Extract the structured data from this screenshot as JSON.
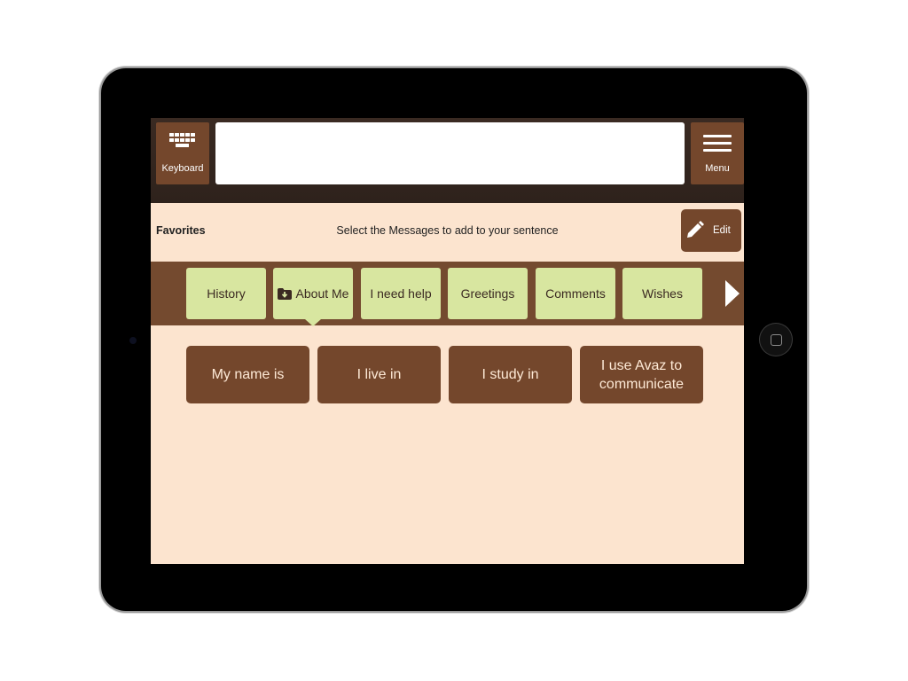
{
  "toolbar": {
    "keyboard_label": "Keyboard",
    "keyboard_icon": "keyboard-icon",
    "menu_label": "Menu",
    "menu_icon": "hamburger-menu-icon",
    "sentence_value": ""
  },
  "favorites": {
    "title": "Favorites",
    "hint": "Select the Messages to add to your sentence",
    "edit_label": "Edit",
    "edit_icon": "pencil-icon"
  },
  "categories": {
    "items": [
      {
        "label": "History"
      },
      {
        "label": "About Me",
        "icon": "folder-download-icon",
        "selected": true
      },
      {
        "label": "I need help"
      },
      {
        "label": "Greetings"
      },
      {
        "label": "Comments"
      },
      {
        "label": "Wishes"
      }
    ],
    "next_icon": "arrow-right-icon"
  },
  "messages": [
    {
      "label": "My name is"
    },
    {
      "label": "I live in"
    },
    {
      "label": "I study in"
    },
    {
      "label": "I use Avaz to communicate"
    }
  ],
  "colors": {
    "brown": "#74472c",
    "category_bar": "#744a2f",
    "background": "#fce4cf",
    "category_tile": "#d8e6a0",
    "topbar": "#2e221c"
  }
}
